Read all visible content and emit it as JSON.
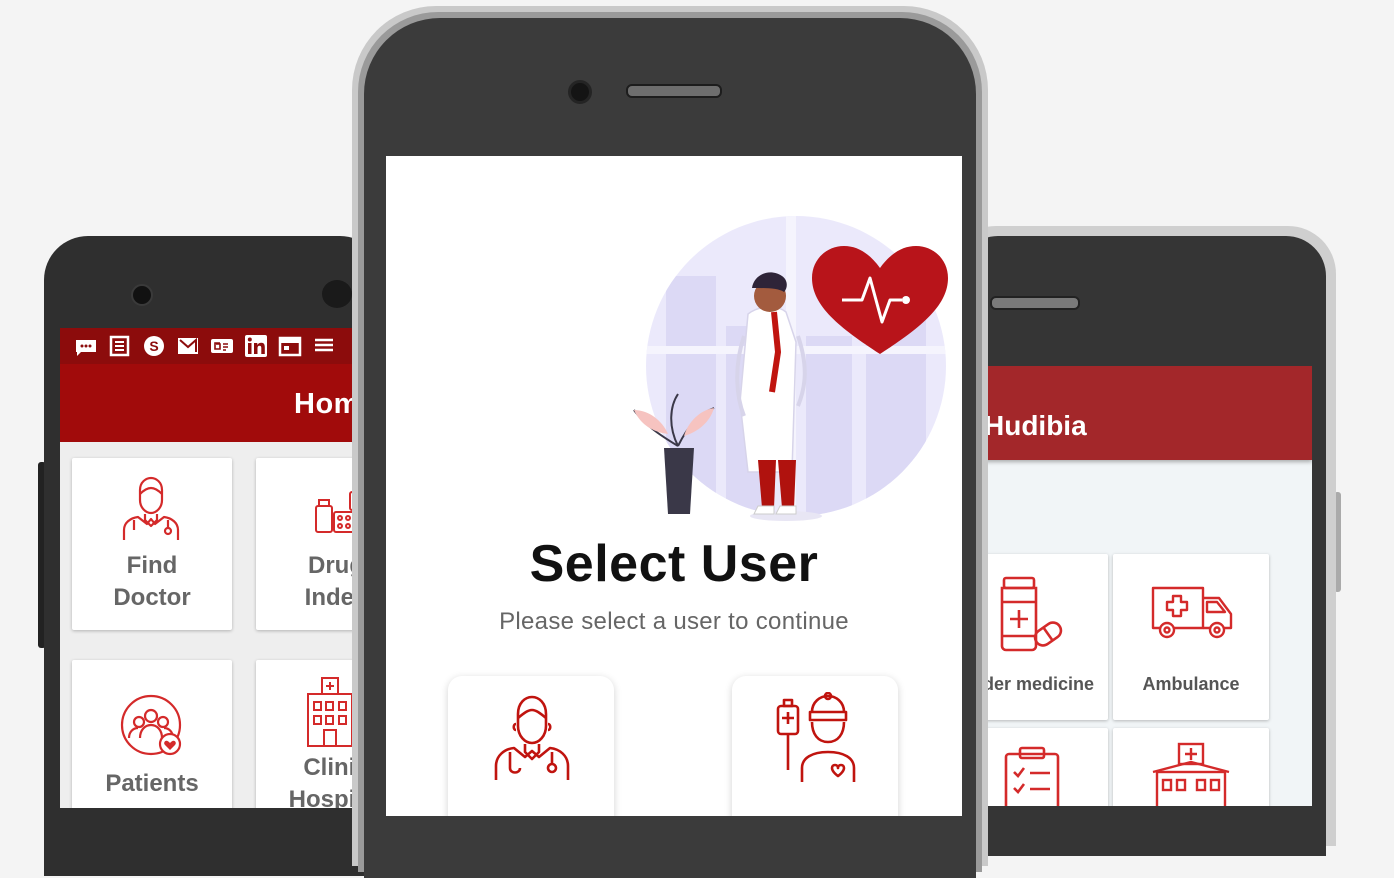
{
  "left_phone": {
    "status_icons": [
      "message-icon",
      "news-icon",
      "skype-icon",
      "gmail-icon",
      "gpay-icon",
      "linkedin-icon",
      "calendar-icon",
      "menu-icon"
    ],
    "appbar_title": "Home",
    "tiles": [
      {
        "label_line1": "Find",
        "label_line2": "Doctor",
        "icon": "doctor-icon"
      },
      {
        "label_line1": "Drug",
        "label_line2": "Index",
        "icon": "medicines-icon"
      },
      {
        "label_line1": "Patients",
        "label_line2": "",
        "icon": "patients-icon"
      },
      {
        "label_line1": "Clinic",
        "label_line2": "Hospital",
        "icon": "hospital-icon"
      }
    ]
  },
  "center_phone": {
    "title": "Select User",
    "subtitle": "Please select a user to continue",
    "cards": [
      {
        "icon": "doctor-user-icon"
      },
      {
        "icon": "patient-user-icon"
      }
    ],
    "illustration": "doctor-with-heart-illustration"
  },
  "right_phone": {
    "appbar_title": "Hudibia",
    "tiles": [
      {
        "label": "Order medicine",
        "icon": "medicine-bottle-icon"
      },
      {
        "label": "Ambulance",
        "icon": "ambulance-icon"
      },
      {
        "label": "",
        "icon": "clipboard-icon"
      },
      {
        "label": "",
        "icon": "hospital-building-icon"
      }
    ]
  },
  "colors": {
    "brand_red": "#a10b0b",
    "status_red": "#8c0c0c",
    "right_bar": "#a3272a",
    "icon_red": "#d42a2a"
  }
}
